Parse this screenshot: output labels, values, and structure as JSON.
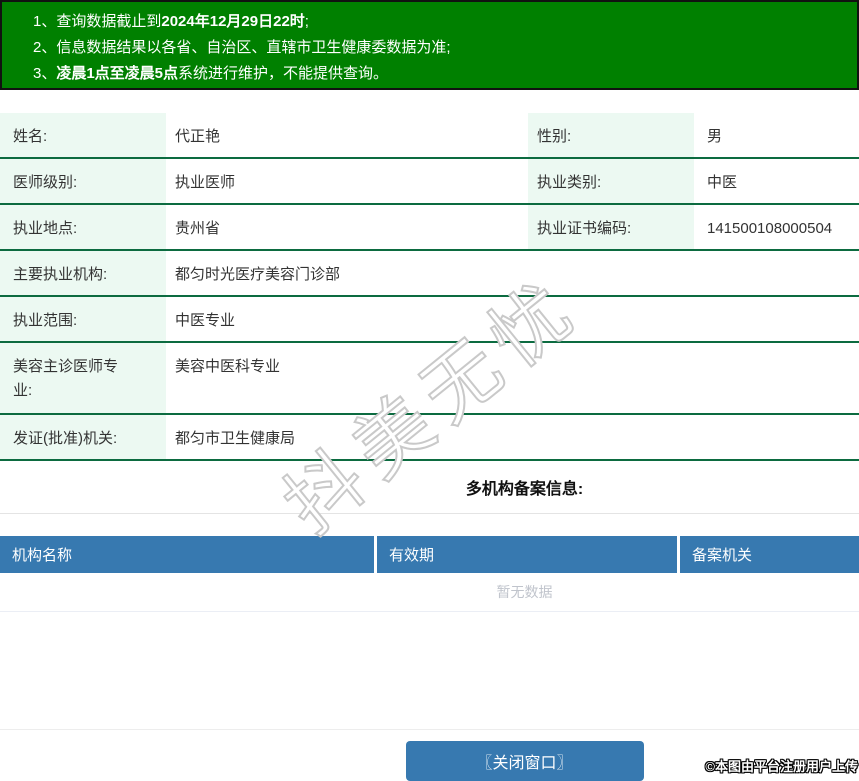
{
  "notice_box": {
    "items": [
      {
        "num": "1、",
        "pre": "查询数据截止到",
        "bold": "2024年12月29日22时",
        "post": ";"
      },
      {
        "num": "2、",
        "pre": "信息数据结果以各省、自治区、直辖市卫生健康委数据为准;",
        "bold": "",
        "post": ""
      },
      {
        "num": "3、",
        "pre": "",
        "bold": "凌晨1点至凌晨5点",
        "post": "系统进行维护，不能提供查询。"
      }
    ]
  },
  "info_rows": [
    {
      "label": "姓名:",
      "value": "代正艳",
      "label2": "性别:",
      "value2": "男"
    },
    {
      "label": "医师级别:",
      "value": "执业医师",
      "label2": "执业类别:",
      "value2": "中医"
    },
    {
      "label": "执业地点:",
      "value": "贵州省",
      "label2": "执业证书编码:",
      "value2": "141500108000504"
    },
    {
      "label": "主要执业机构:",
      "value": "都匀时光医疗美容门诊部"
    },
    {
      "label": "执业范围:",
      "value": "中医专业"
    },
    {
      "label": "美容主诊医师专业:",
      "value": "美容中医科专业"
    },
    {
      "label": "发证(批准)机关:",
      "value": "都匀市卫生健康局"
    }
  ],
  "filing_section": {
    "title": "多机构备案信息:",
    "columns": [
      "机构名称",
      "有效期",
      "备案机关"
    ],
    "empty_text": "暂无数据"
  },
  "footer": {
    "close_button": "〖关闭窗口〗",
    "copyright": "©本图由平台注册用户上传"
  },
  "watermark": {
    "text": "抖美无忧"
  },
  "colors": {
    "notice_bg": "#008000",
    "divider_green": "#0c6b40",
    "label_bg": "#ecf9f2",
    "accent_blue": "#3779b0",
    "empty_text_gray": "#c0c4cc"
  }
}
